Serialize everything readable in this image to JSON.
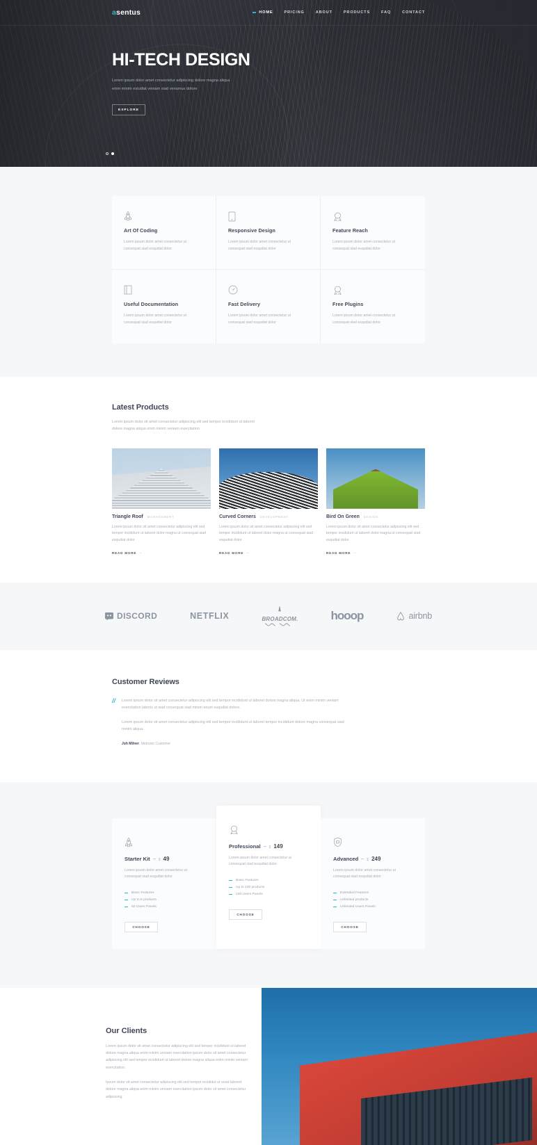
{
  "site": {
    "logo_accent_letter": "a",
    "logo_rest": "sentus",
    "accent_color": "#2ab6c8"
  },
  "nav": {
    "items": [
      {
        "label": "HOME",
        "active": true
      },
      {
        "label": "PRICING",
        "active": false
      },
      {
        "label": "ABOUT",
        "active": false
      },
      {
        "label": "PRODUCTS",
        "active": false
      },
      {
        "label": "FAQ",
        "active": false
      },
      {
        "label": "CONTACT",
        "active": false
      }
    ]
  },
  "hero": {
    "title": "HI-TECH DESIGN",
    "subtitle": "Lorem ipsum dolor amet consectetur adipiscing dolore magna aliqua enim minim estudiat veniam siad venumus dolore",
    "button": "EXPLORE",
    "slide_count": 2,
    "active_slide": 2
  },
  "features": {
    "items": [
      {
        "icon": "rocket-icon",
        "title": "Art Of Coding",
        "desc": "Lorem ipsum dolor amet consectetur ut consequat siad esqudiat dolor"
      },
      {
        "icon": "tablet-icon",
        "title": "Responsive Design",
        "desc": "Lorem ipsum dolor amet consectetur ut consequat siad esqudiat dolor"
      },
      {
        "icon": "award-icon",
        "title": "Feature Reach",
        "desc": "Lorem ipsum dolor amet consectetur ut consequat siad esqudiat dolor"
      },
      {
        "icon": "book-icon",
        "title": "Useful Documentation",
        "desc": "Lorem ipsum dolor amet consectetur ut consequat siad esqudiat dolor"
      },
      {
        "icon": "speedometer-icon",
        "title": "Fast Delivery",
        "desc": "Lorem ipsum dolor amet consectetur ut consequat siad esqudiat dolor"
      },
      {
        "icon": "award-icon",
        "title": "Free Plugins",
        "desc": "Lorem ipsum dolor amet consectetur ut consequat siad esqudiat dolor"
      }
    ]
  },
  "products": {
    "title": "Latest Products",
    "subtitle": "Lorem ipsum dolor sit amet consectetur adipiscing elit sed tempor incididunt ut laboret dolore magna aliqua enim minim veniam exercitation",
    "read_more_label": "READ MORE",
    "items": [
      {
        "image": "triangle-roof-photo",
        "name": "Triangle Roof",
        "category": "MANAGEMENT",
        "desc": "Lorem ipsum dolor sit amet consectetur adipiscing elit sed tempor incididunt ut laboret dolor magna ut consequat siad esqudiat dolor"
      },
      {
        "image": "curved-corners-photo",
        "name": "Curved Corners",
        "category": "DEVELOPMENT",
        "desc": "Lorem ipsum dolor sit amet consectetur adipiscing elit sed tempor incididunt ut laboret dolor magna ut consequat siad esqudiat dolor"
      },
      {
        "image": "bird-on-green-photo",
        "name": "Bird On Green",
        "category": "DESIGN",
        "desc": "Lorem ipsum dolor sit amet consectetur adipiscing elit sed tempor incididunt ut laboret dolor magna ut consequat siad esqudiat dolor"
      }
    ]
  },
  "brands": {
    "items": [
      {
        "name": "DISCORD",
        "icon": "discord-icon"
      },
      {
        "name": "NETFLIX",
        "icon": "netflix-wordmark"
      },
      {
        "name": "BROADCOM.",
        "icon": "broadcom-icon"
      },
      {
        "name": "hooop",
        "icon": "hooop-wordmark"
      },
      {
        "name": "airbnb",
        "icon": "airbnb-icon"
      }
    ]
  },
  "reviews": {
    "title": "Customer Reviews",
    "paragraph1": "Lorem ipsum dolor sit amet consectetur adipiscing elit sed tempor incididunt ut laboret dolore magna aliqua. Ut enim minim veniam exercitation laboris ut siad consequat siad minim enum esqudiat dolore.",
    "paragraph2": "Lorem ipsum dolor sit amet consectetur adipiscing elit sed tempor incididunt ut laboret tempor incididunt dolore magna consequat siad minim aliqua.",
    "author_name": "Joh Milner",
    "author_role": ", Metronic Customer"
  },
  "pricing": {
    "choose_label": "CHOOSE",
    "currency": "$",
    "plans": [
      {
        "icon": "rocket-icon",
        "name": "Starter Kit",
        "price": "49",
        "desc": "Lorem ipsum dolor amet consectetur ut consequat siad esqudiat dolor",
        "features": [
          "Basic Features",
          "Up to 5 products",
          "50 Users Panels"
        ],
        "featured": false
      },
      {
        "icon": "award-icon",
        "name": "Professional",
        "price": "149",
        "desc": "Lorem ipsum dolor amet consectetur ut consequat siad esqudiat dolor",
        "features": [
          "Basic Features",
          "Up to 100 products",
          "100 Users Panels"
        ],
        "featured": true
      },
      {
        "icon": "shield-icon",
        "name": "Advanced",
        "price": "249",
        "desc": "Lorem ipsum dolor amet consectetur ut consequat siad esqudiat dolor",
        "features": [
          "Extended Features",
          "Unlimited products",
          "Unlimited Users Panels"
        ],
        "featured": false
      }
    ]
  },
  "clients": {
    "title": "Our Clients",
    "paragraph1": "Lorem ipsum dolor sit amet consectetur adipiscing elit sed tempor incididunt ut laboret dolore magna aliqua enim minim veniam exercitation ipsum dolor sit amet consectetur adipiscing elit sed tempor incididunt ut laboret dolore magna aliqua enim minim veniam exercitation.",
    "paragraph2": "Ipsum dolor sit amet consectetur adipiscing elit sed tempor incididut ut sead laboret dolore magna aliqua enim minim veniam exercitation ipsum dolor sit amet consectetur adipiscing",
    "image": "red-building-photo"
  }
}
